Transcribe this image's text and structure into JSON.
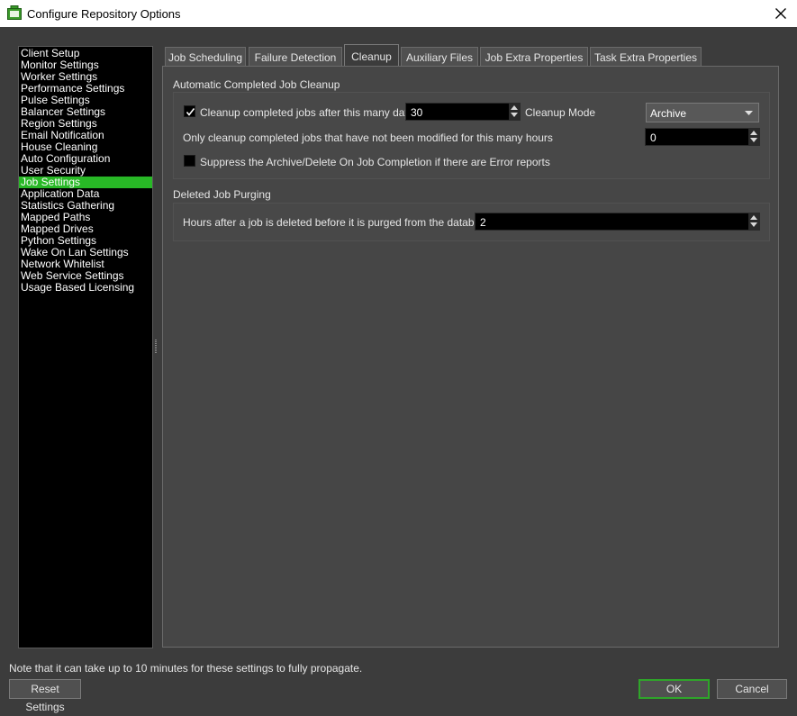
{
  "window": {
    "title": "Configure Repository Options"
  },
  "sidebar": {
    "items": [
      {
        "label": "Client Setup"
      },
      {
        "label": "Monitor Settings"
      },
      {
        "label": "Worker Settings"
      },
      {
        "label": "Performance Settings"
      },
      {
        "label": "Pulse Settings"
      },
      {
        "label": "Balancer Settings"
      },
      {
        "label": "Region Settings"
      },
      {
        "label": "Email Notification"
      },
      {
        "label": "House Cleaning"
      },
      {
        "label": "Auto Configuration"
      },
      {
        "label": "User Security"
      },
      {
        "label": "Job Settings",
        "selected": true
      },
      {
        "label": "Application Data"
      },
      {
        "label": "Statistics Gathering"
      },
      {
        "label": "Mapped Paths"
      },
      {
        "label": "Mapped Drives"
      },
      {
        "label": "Python Settings"
      },
      {
        "label": "Wake On Lan Settings"
      },
      {
        "label": "Network Whitelist"
      },
      {
        "label": "Web Service Settings"
      },
      {
        "label": "Usage Based Licensing"
      }
    ]
  },
  "tabs": [
    {
      "label": "Job Scheduling"
    },
    {
      "label": "Failure Detection"
    },
    {
      "label": "Cleanup",
      "active": true
    },
    {
      "label": "Auxiliary Files"
    },
    {
      "label": "Job Extra Properties"
    },
    {
      "label": "Task Extra Properties"
    }
  ],
  "cleanup": {
    "group_title": "Automatic Completed Job Cleanup",
    "cleanup_checkbox": {
      "label": "Cleanup completed jobs after this many days",
      "checked": true
    },
    "days_value": "30",
    "mode_label": "Cleanup Mode",
    "mode_value": "Archive",
    "hours_label": "Only cleanup completed jobs that have not been modified for this many hours",
    "hours_value": "0",
    "suppress_checkbox": {
      "label": "Suppress the Archive/Delete On Job Completion if there are Error reports",
      "checked": false
    }
  },
  "purging": {
    "group_title": "Deleted Job Purging",
    "hours_label": "Hours after a job is deleted before it is purged from the database",
    "hours_value": "2"
  },
  "footer": {
    "note": "Note that it can take up to 10 minutes for these settings to fully propagate.",
    "reset_label": "Reset Settings",
    "ok_label": "OK",
    "cancel_label": "Cancel"
  },
  "colors": {
    "selection": "#28b826",
    "ok_border": "#2fa52a",
    "app_icon": "#3a9a2a"
  },
  "icons": [
    "app-icon",
    "close-icon",
    "checkmark-icon",
    "spin-up-icon",
    "spin-down-icon",
    "dropdown-arrow-icon"
  ]
}
